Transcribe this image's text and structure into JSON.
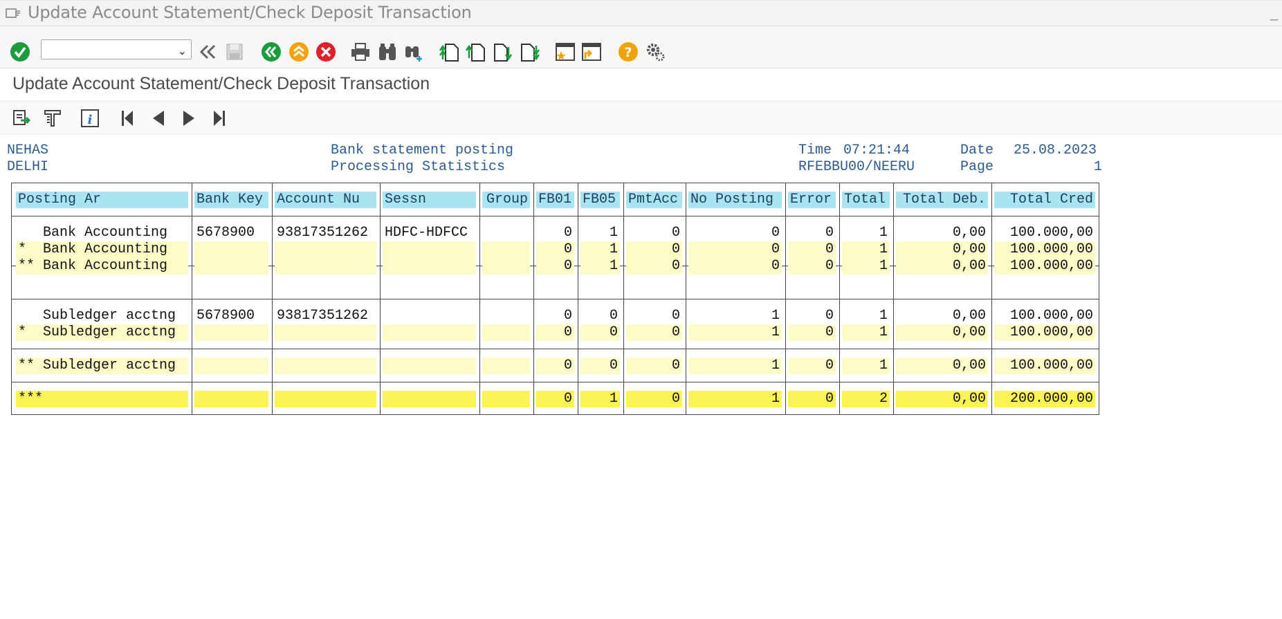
{
  "window": {
    "title": "Update Account Statement/Check Deposit Transaction"
  },
  "toolbar": {
    "command_field_value": "",
    "buttons": [
      "enter-icon",
      "back-double-icon",
      "save-icon",
      "back-icon",
      "exit-icon",
      "cancel-icon",
      "print-icon",
      "find-icon",
      "find-next-icon",
      "first-page-icon",
      "previous-page-icon",
      "next-page-icon",
      "last-page-icon",
      "new-session-icon",
      "shortcut-icon",
      "help-icon",
      "settings-icon"
    ]
  },
  "screen": {
    "title": "Update Account Statement/Check Deposit Transaction"
  },
  "report_header": {
    "user": "NEHAS",
    "city": "DELHI",
    "line1": "Bank statement posting",
    "line2": "Processing Statistics",
    "time_label": "Time",
    "time_value": "07:21:44",
    "date_label": "Date",
    "date_value": "25.08.2023",
    "program": "RFEBBU00/NEERU",
    "page_label": "Page",
    "page_value": "1"
  },
  "table": {
    "columns": [
      "Posting Ar",
      "Bank Key",
      "Account Nu",
      "Sessn",
      "Group",
      "FB01",
      "FB05",
      "PmtAcc",
      "No Posting",
      "Error",
      "Total",
      "Total Deb.",
      "Total Cred"
    ],
    "rows": [
      {
        "style": "normal",
        "cells": [
          "   Bank Accounting",
          "5678900",
          "93817351262",
          "HDFC-HDFCC",
          "",
          "0",
          "1",
          "0",
          "0",
          "0",
          "1",
          "0,00",
          "100.000,00"
        ]
      },
      {
        "style": "subtotal",
        "cells": [
          "*  Bank Accounting",
          "",
          "",
          "",
          "",
          "0",
          "1",
          "0",
          "0",
          "0",
          "1",
          "0,00",
          "100.000,00"
        ]
      },
      {
        "style": "subtotal",
        "cells": [
          "** Bank Accounting",
          "",
          "",
          "",
          "",
          "0",
          "1",
          "0",
          "0",
          "0",
          "1",
          "0,00",
          "100.000,00"
        ]
      },
      {
        "style": "normal",
        "cells": [
          "   Subledger acctng",
          "5678900",
          "93817351262",
          "",
          "",
          "0",
          "0",
          "0",
          "1",
          "0",
          "1",
          "0,00",
          "100.000,00"
        ]
      },
      {
        "style": "subtotal",
        "cells": [
          "*  Subledger acctng",
          "",
          "",
          "",
          "",
          "0",
          "0",
          "0",
          "1",
          "0",
          "1",
          "0,00",
          "100.000,00"
        ]
      },
      {
        "style": "subtotal",
        "cells": [
          "** Subledger acctng",
          "",
          "",
          "",
          "",
          "0",
          "0",
          "0",
          "1",
          "0",
          "1",
          "0,00",
          "100.000,00"
        ]
      },
      {
        "style": "grand",
        "cells": [
          "***",
          "",
          "",
          "",
          "",
          "0",
          "1",
          "0",
          "1",
          "0",
          "2",
          "0,00",
          "200.000,00"
        ]
      }
    ]
  },
  "colors": {
    "header_bg": "#a9e4f3",
    "subtotal_bg": "#fefcc6",
    "grand_bg": "#fbf453",
    "report_text": "#2d5a8f"
  }
}
